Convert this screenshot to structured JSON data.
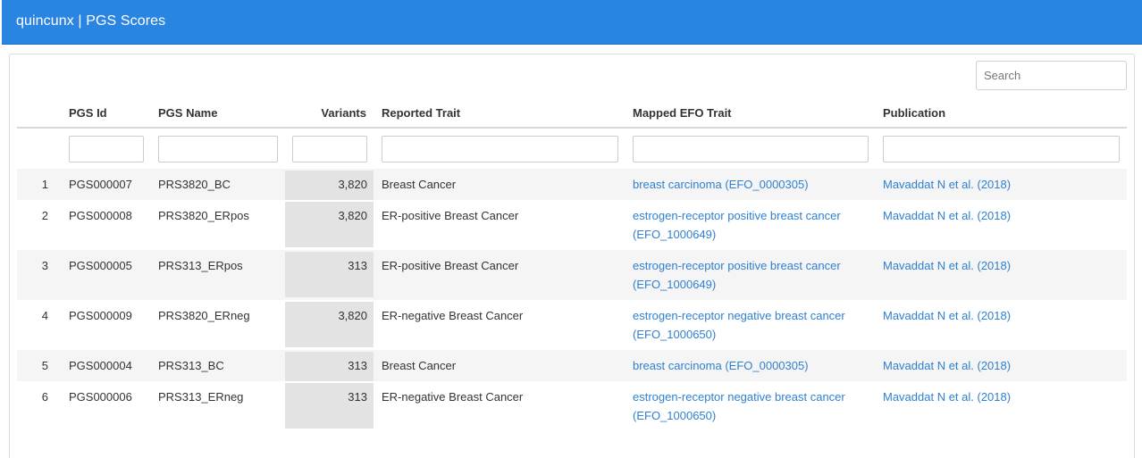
{
  "app": {
    "title": "quincunx | PGS Scores"
  },
  "search": {
    "placeholder": "Search"
  },
  "table": {
    "columns": [
      "PGS Id",
      "PGS Name",
      "Variants",
      "Reported Trait",
      "Mapped EFO Trait",
      "Publication"
    ],
    "rows": [
      {
        "index": "1",
        "pgs_id": "PGS000007",
        "pgs_name": "PRS3820_BC",
        "variants": "3,820",
        "reported_trait": "Breast Cancer",
        "efo_line1": "breast carcinoma (EFO_0000305)",
        "efo_line2": "",
        "publication": "Mavaddat N et al. (2018)"
      },
      {
        "index": "2",
        "pgs_id": "PGS000008",
        "pgs_name": "PRS3820_ERpos",
        "variants": "3,820",
        "reported_trait": "ER-positive Breast Cancer",
        "efo_line1": "estrogen-receptor positive breast cancer",
        "efo_line2": "(EFO_1000649)",
        "publication": "Mavaddat N et al. (2018)"
      },
      {
        "index": "3",
        "pgs_id": "PGS000005",
        "pgs_name": "PRS313_ERpos",
        "variants": "313",
        "reported_trait": "ER-positive Breast Cancer",
        "efo_line1": "estrogen-receptor positive breast cancer",
        "efo_line2": "(EFO_1000649)",
        "publication": "Mavaddat N et al. (2018)"
      },
      {
        "index": "4",
        "pgs_id": "PGS000009",
        "pgs_name": "PRS3820_ERneg",
        "variants": "3,820",
        "reported_trait": "ER-negative Breast Cancer",
        "efo_line1": "estrogen-receptor negative breast cancer",
        "efo_line2": "(EFO_1000650)",
        "publication": "Mavaddat N et al. (2018)"
      },
      {
        "index": "5",
        "pgs_id": "PGS000004",
        "pgs_name": "PRS313_BC",
        "variants": "313",
        "reported_trait": "Breast Cancer",
        "efo_line1": "breast carcinoma (EFO_0000305)",
        "efo_line2": "",
        "publication": "Mavaddat N et al. (2018)"
      },
      {
        "index": "6",
        "pgs_id": "PGS000006",
        "pgs_name": "PRS313_ERneg",
        "variants": "313",
        "reported_trait": "ER-negative Breast Cancer",
        "efo_line1": "estrogen-receptor negative breast cancer",
        "efo_line2": "(EFO_1000650)",
        "publication": "Mavaddat N et al. (2018)"
      }
    ]
  },
  "colors": {
    "header_bar": "#2a85e2",
    "link": "#2f80d1",
    "variants_shade": "#e3e3e3",
    "stripe": "#f5f5f5"
  }
}
